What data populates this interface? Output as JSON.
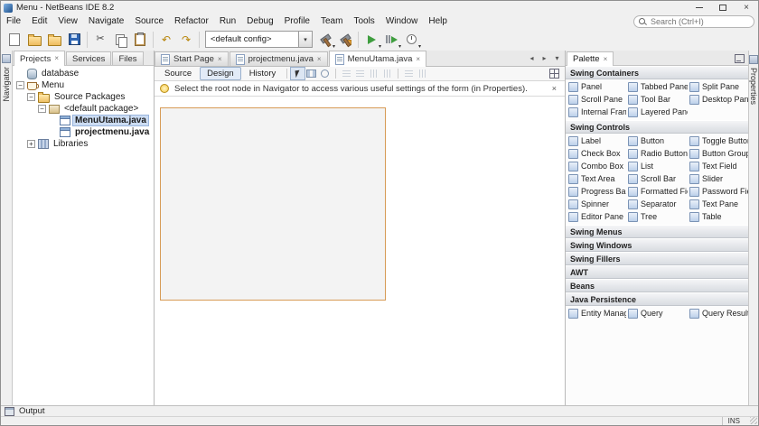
{
  "window": {
    "title": "Menu - NetBeans IDE 8.2"
  },
  "menubar": {
    "items": [
      "File",
      "Edit",
      "View",
      "Navigate",
      "Source",
      "Refactor",
      "Run",
      "Debug",
      "Profile",
      "Team",
      "Tools",
      "Window",
      "Help"
    ],
    "search_placeholder": "Search (Ctrl+I)"
  },
  "toolbar": {
    "config_value": "<default config>"
  },
  "left_strip": {
    "label": "Navigator"
  },
  "right_strip": {
    "label": "Properties"
  },
  "explorer": {
    "tabs": [
      {
        "label": "Projects",
        "active": true,
        "closable": true
      },
      {
        "label": "Services",
        "active": false,
        "closable": false
      },
      {
        "label": "Files",
        "active": false,
        "closable": false
      }
    ],
    "tree": [
      {
        "label": "database",
        "indent": 0,
        "icon": "database",
        "handle": "",
        "selected": false,
        "bold": false
      },
      {
        "label": "Menu",
        "indent": 0,
        "icon": "project",
        "handle": "minus",
        "selected": false,
        "bold": false
      },
      {
        "label": "Source Packages",
        "indent": 1,
        "icon": "source-folder",
        "handle": "minus",
        "selected": false,
        "bold": false
      },
      {
        "label": "<default package>",
        "indent": 2,
        "icon": "package",
        "handle": "minus",
        "selected": false,
        "bold": false
      },
      {
        "label": "MenuUtama.java",
        "indent": 3,
        "icon": "form",
        "handle": "",
        "selected": true,
        "bold": true
      },
      {
        "label": "projectmenu.java",
        "indent": 3,
        "icon": "form",
        "handle": "",
        "selected": false,
        "bold": true
      },
      {
        "label": "Libraries",
        "indent": 1,
        "icon": "libraries",
        "handle": "plus",
        "selected": false,
        "bold": false
      }
    ]
  },
  "editor": {
    "tabs": [
      {
        "label": "Start Page",
        "active": false
      },
      {
        "label": "projectmenu.java",
        "active": false
      },
      {
        "label": "MenuUtama.java",
        "active": true
      }
    ],
    "views": [
      {
        "label": "Source",
        "active": false
      },
      {
        "label": "Design",
        "active": true
      },
      {
        "label": "History",
        "active": false
      }
    ],
    "info_message": "Select the root node in Navigator to access various useful settings of the form (in Properties)."
  },
  "palette": {
    "title": "Palette",
    "sections": [
      {
        "label": "Swing Containers",
        "expanded": true,
        "items": [
          "Panel",
          "Tabbed Pane",
          "Split Pane",
          "Scroll Pane",
          "Tool Bar",
          "Desktop Pane",
          "Internal Frame",
          "Layered Pane"
        ]
      },
      {
        "label": "Swing Controls",
        "expanded": true,
        "items": [
          "Label",
          "Button",
          "Toggle Button",
          "Check Box",
          "Radio Button",
          "Button Group",
          "Combo Box",
          "List",
          "Text Field",
          "Text Area",
          "Scroll Bar",
          "Slider",
          "Progress Bar",
          "Formatted Field",
          "Password Field",
          "Spinner",
          "Separator",
          "Text Pane",
          "Editor Pane",
          "Tree",
          "Table"
        ]
      },
      {
        "label": "Swing Menus",
        "expanded": false,
        "items": []
      },
      {
        "label": "Swing Windows",
        "expanded": false,
        "items": []
      },
      {
        "label": "Swing Fillers",
        "expanded": false,
        "items": []
      },
      {
        "label": "AWT",
        "expanded": false,
        "items": []
      },
      {
        "label": "Beans",
        "expanded": false,
        "items": []
      },
      {
        "label": "Java Persistence",
        "expanded": true,
        "items": [
          "Entity Manager",
          "Query",
          "Query Result"
        ]
      }
    ]
  },
  "output": {
    "label": "Output"
  },
  "statusbar": {
    "insert_mode": "INS"
  },
  "icons": {
    "close": "×",
    "minus": "−",
    "plus": "+",
    "dropdown": "▾",
    "scroll_left": "◂",
    "scroll_right": "▸",
    "undo": "↶",
    "redo": "↷",
    "cut": "✂"
  },
  "colors": {
    "form_border": "#d79b56",
    "selection": "#cbdcf3",
    "run_green": "#3f9e3f"
  }
}
